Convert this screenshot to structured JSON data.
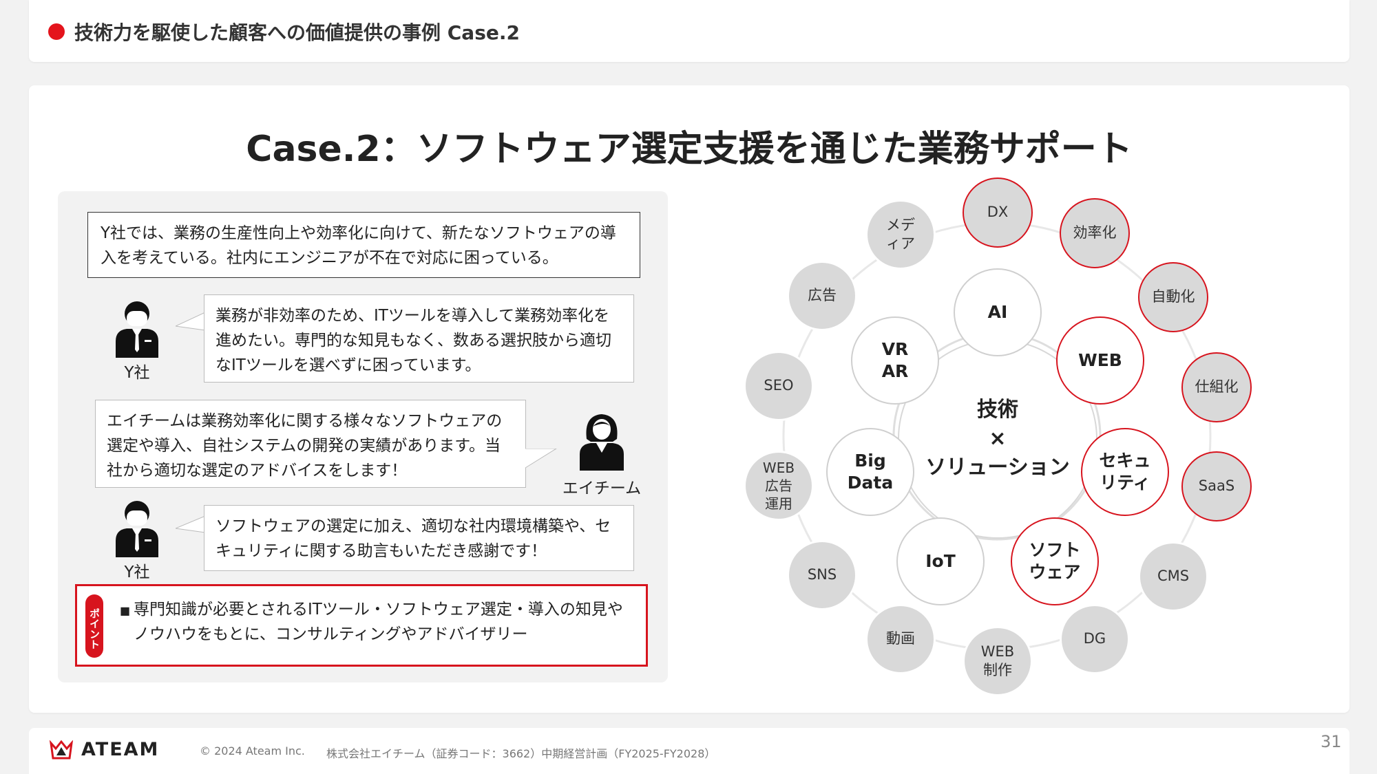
{
  "header": {
    "title": "技術力を駆使した顧客への価値提供の事例 Case.2"
  },
  "main": {
    "title": "Case.2：ソフトウェア選定支援を通じた業務サポート",
    "intro": "Y社では、業務の生産性向上や効率化に向けて、新たなソフトウェアの導入を考えている。社内にエンジニアが不在で対応に困っている。",
    "bubble1": "業務が非効率のため、ITツールを導入して業務効率化を進めたい。専門的な知見もなく、数ある選択肢から適切なITツールを選べずに困っています。",
    "person1": "Y社",
    "bubble2": "エイチームは業務効率化に関する様々なソフトウェアの選定や導入、自社システムの開発の実績があります。当社から適切な選定のアドバイスをします！",
    "person2": "エイチーム",
    "bubble3": "ソフトウェアの選定に加え、適切な社内環境構築や、セキュリティに関する助言もいただき感謝です！",
    "person3": "Y社",
    "point_tag": "ポイント",
    "point_text": "専門知識が必要とされるITツール・ソフトウェア選定・導入の知見やノウハウをもとに、コンサルティングやアドバイザリー"
  },
  "diagram": {
    "center": "技術\n×\nソリューション",
    "inner": {
      "ai": "AI",
      "web": "WEB",
      "security": "セキュ\nリティ",
      "software": "ソフト\nウェア",
      "iot": "IoT",
      "bigdata": "Big\nData",
      "vrar": "VR\nAR"
    },
    "outer": {
      "dx": "DX",
      "efficiency": "効率化",
      "automation": "自動化",
      "mechanism": "仕組化",
      "saas": "SaaS",
      "cms": "CMS",
      "dg": "DG",
      "webprod": "WEB\n制作",
      "video": "動画",
      "sns": "SNS",
      "webad": "WEB\n広告\n運用",
      "seo": "SEO",
      "ad": "広告",
      "media": "メデ\nィア"
    }
  },
  "footer": {
    "logo": "ATEAM",
    "copyright": "© 2024 Ateam Inc.",
    "note": "株式会社エイチーム（証券コード：3662）中期経営計画（FY2025-FY2028）",
    "page": "31"
  },
  "colors": {
    "accent": "#d7141e",
    "grey_circle": "#d9d9d9"
  }
}
